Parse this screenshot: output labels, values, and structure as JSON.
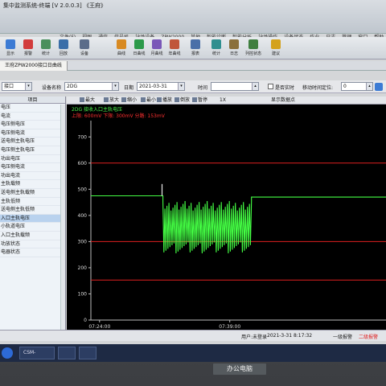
{
  "window": {
    "title": "集中监测系统-终端 [V 2.0.0.3] 《王府》"
  },
  "menu": [
    "文件(F)",
    "视图",
    "通信",
    "信号机",
    "站场设备",
    "ZPW2000",
    "其他",
    "智能诊断",
    "智能分析",
    "站场操作",
    "设备状态",
    "作业",
    "日志",
    "管理",
    "窗口",
    "帮助"
  ],
  "toolbar": [
    {
      "label": "显示",
      "icon": "monitor-icon",
      "color": "#3c7bd4"
    },
    {
      "label": "报警",
      "icon": "alarm-icon",
      "color": "#d23c3c"
    },
    {
      "label": "统计",
      "icon": "stats-icon",
      "color": "#4a8f5c"
    },
    {
      "label": "回放",
      "icon": "replay-icon",
      "color": "#3a6ea8"
    },
    {
      "label": "设备",
      "icon": "device-icon",
      "color": "#5b6d8a"
    },
    {
      "label": "曲线",
      "icon": "curve-icon",
      "color": "#d88a22"
    },
    {
      "label": "日曲线",
      "icon": "day-curve-icon",
      "color": "#2b9a4a"
    },
    {
      "label": "月曲线",
      "icon": "month-curve-icon",
      "color": "#7a57b8"
    },
    {
      "label": "年曲线",
      "icon": "year-curve-icon",
      "color": "#c0563a"
    },
    {
      "label": "报表",
      "icon": "report-icon",
      "color": "#4a6fa8"
    },
    {
      "label": "统计",
      "icon": "stats2-icon",
      "color": "#2f8f8f"
    },
    {
      "label": "日志",
      "icon": "log-icon",
      "color": "#8a6f3a"
    },
    {
      "label": "列控状态",
      "icon": "train-control-icon",
      "color": "#3f7f3f"
    },
    {
      "label": "建议",
      "icon": "suggest-icon",
      "color": "#d4a21c"
    }
  ],
  "doc_tab": "王府ZPW2000接口日曲线",
  "filter": {
    "type_value": "接口",
    "device_label": "设备名称",
    "device_value": "2DG",
    "date_label": "日期",
    "date_value": "2021-03-31",
    "time_label": "时间",
    "time_value": "",
    "realtime_label": "是否实时",
    "interval_label": "移动时间定位:",
    "interval_value": "0"
  },
  "left_panel": {
    "header": "项目",
    "items": [
      "电压",
      "电流",
      "电压侧电压",
      "电压侧电流",
      "送电侧主轨电压",
      "电压侧主轨电压",
      "功出电压",
      "电压侧电流",
      "功出电流",
      "主轨载频",
      "送电侧主轨载频",
      "主轨低频",
      "送电侧主轨低频",
      "入口主轨电压",
      "小轨道电压",
      "入口主轨载频",
      "功放状态",
      "电器状态"
    ],
    "selected": 13
  },
  "chart_toolbar": {
    "items": [
      "最大",
      "放大",
      "缩小",
      "最小",
      "播放",
      "倒放",
      "暂停"
    ],
    "zoom_value": "1X",
    "cursor_label": "显示数据点"
  },
  "chart_data": {
    "type": "line",
    "title": "2DG 接收入口主轨电压",
    "limits_text": "上限: 600mV  下限: 300mV  分路: 153mV",
    "y_ticks": [
      0,
      100,
      200,
      300,
      400,
      500,
      600,
      700
    ],
    "ylim": [
      0,
      750
    ],
    "x_ticks": [
      "07:24:00",
      "07:39:00"
    ],
    "xlim_min": [
      23,
      57
    ],
    "thresholds": [
      {
        "name": "上限",
        "value": 600,
        "color": "#e02020"
      },
      {
        "name": "下限",
        "value": 300,
        "color": "#e02020"
      },
      {
        "name": "分路",
        "value": 153,
        "color": "#e02020"
      }
    ],
    "series": [
      {
        "color": "#44ff44",
        "segments": [
          {
            "from": 23.0,
            "to": 31.3,
            "level": 475
          },
          {
            "from": 31.3,
            "to": 41.5,
            "low": 255,
            "high": 455,
            "oscillating": true
          },
          {
            "from": 41.5,
            "to": 57.0,
            "level": 470
          }
        ],
        "spike": {
          "x": 31.2,
          "value": 520
        }
      }
    ]
  },
  "statusbar": {
    "user": "用户:未登录",
    "datetime": "2021-3-31  8:17:32",
    "alarm_tip": "一级报警",
    "alarm2": "二级报警"
  },
  "taskbar": {
    "tasks": [
      "CSM-",
      "",
      ""
    ]
  },
  "monitor": {
    "label": "办公电脑"
  }
}
